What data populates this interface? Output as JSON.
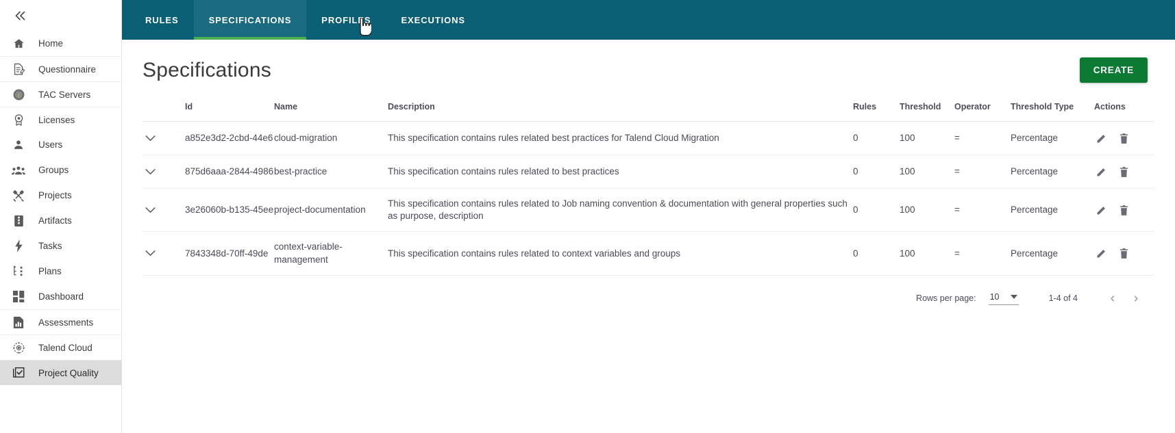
{
  "sidebar": {
    "collapse_icon": "chevron-double-left-icon",
    "items": [
      {
        "label": "Home",
        "icon": "home-icon",
        "active": false
      },
      {
        "label": "Questionnaire",
        "icon": "document-edit-icon",
        "active": false
      },
      {
        "label": "TAC Servers",
        "icon": "talend-circle-icon",
        "active": false
      },
      {
        "label": "Licenses",
        "icon": "license-badge-icon",
        "active": false
      },
      {
        "label": "Users",
        "icon": "user-icon",
        "active": false
      },
      {
        "label": "Groups",
        "icon": "group-icon",
        "active": false
      },
      {
        "label": "Projects",
        "icon": "tools-icon",
        "active": false
      },
      {
        "label": "Artifacts",
        "icon": "artifact-icon",
        "active": false
      },
      {
        "label": "Tasks",
        "icon": "bolt-icon",
        "active": false
      },
      {
        "label": "Plans",
        "icon": "plan-tree-icon",
        "active": false
      },
      {
        "label": "Dashboard",
        "icon": "dashboard-grid-icon",
        "active": false
      },
      {
        "label": "Assessments",
        "icon": "report-chart-icon",
        "active": false
      },
      {
        "label": "Talend Cloud",
        "icon": "cloud-target-icon",
        "active": false
      },
      {
        "label": "Project Quality",
        "icon": "quality-check-icon",
        "active": true
      }
    ]
  },
  "tabs": [
    {
      "label": "RULES",
      "active": false
    },
    {
      "label": "SPECIFICATIONS",
      "active": true
    },
    {
      "label": "PROFILES",
      "active": false
    },
    {
      "label": "EXECUTIONS",
      "active": false
    }
  ],
  "page": {
    "title": "Specifications",
    "create_label": "CREATE"
  },
  "table": {
    "headers": {
      "expand": "",
      "id": "Id",
      "name": "Name",
      "description": "Description",
      "rules": "Rules",
      "threshold": "Threshold",
      "operator": "Operator",
      "threshold_type": "Threshold Type",
      "actions": "Actions"
    },
    "rows": [
      {
        "id": "a852e3d2-2cbd-44e6",
        "name": "cloud-migration",
        "description": "This specification contains rules related best practices for Talend Cloud Migration",
        "rules": "0",
        "threshold": "100",
        "operator": "=",
        "threshold_type": "Percentage"
      },
      {
        "id": "875d6aaa-2844-4986",
        "name": "best-practice",
        "description": "This specification contains rules related to best practices",
        "rules": "0",
        "threshold": "100",
        "operator": "=",
        "threshold_type": "Percentage"
      },
      {
        "id": "3e26060b-b135-45ee",
        "name": "project-documentation",
        "description": "This specification contains rules related to Job naming convention & documentation with general properties such as purpose, description",
        "rules": "0",
        "threshold": "100",
        "operator": "=",
        "threshold_type": "Percentage"
      },
      {
        "id": "7843348d-70ff-49de",
        "name": "context-variable-management",
        "description": "This specification contains rules related to context variables and groups",
        "rules": "0",
        "threshold": "100",
        "operator": "=",
        "threshold_type": "Percentage"
      }
    ]
  },
  "pagination": {
    "rows_per_page_label": "Rows per page:",
    "rows_per_page_value": "10",
    "range": "1-4 of 4",
    "prev_glyph": "‹",
    "next_glyph": "›"
  },
  "colors": {
    "tabbar": "#0b5f75",
    "tab_active": "#1a6b80",
    "tab_underline": "#4caf50",
    "create_green": "#0c7a33",
    "sidebar_active": "#dcdcdc"
  }
}
